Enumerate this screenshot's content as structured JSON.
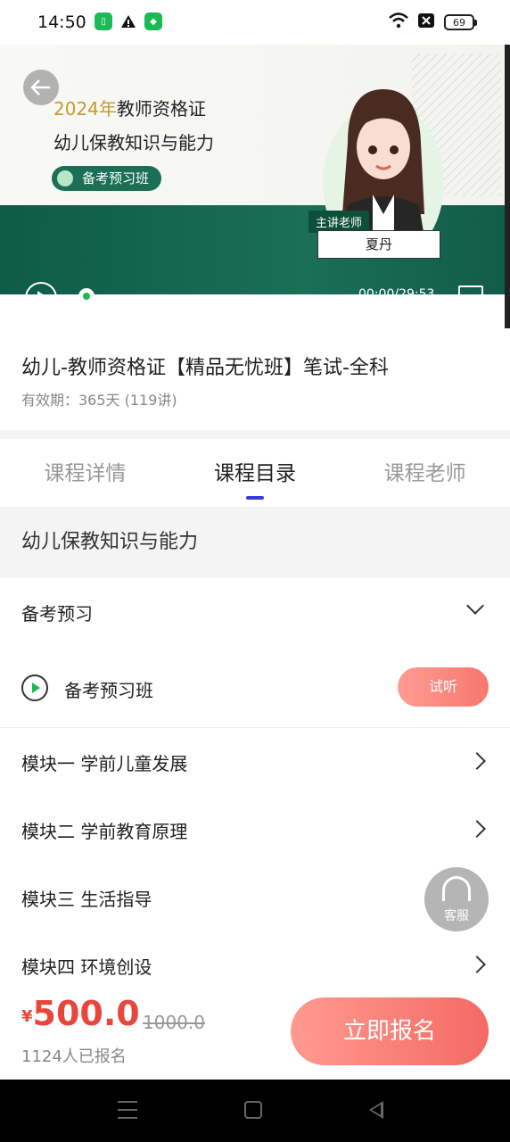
{
  "status_bar": {
    "time": "14:50",
    "left_icons": [
      "sim-icon",
      "warning-icon",
      "shield-icon"
    ],
    "right_icons": [
      "wifi-icon",
      "x-icon"
    ],
    "battery": "69"
  },
  "banner": {
    "year_text": "2024年",
    "title_rest": "教师资格证",
    "subtitle": "幼儿保教知识与能力",
    "pill": "备考预习班",
    "teacher_tag": "主讲老师",
    "teacher_name": "夏丹",
    "video_time": "00:00/29:53",
    "progress": 0.0
  },
  "course": {
    "title": "幼儿-教师资格证【精品无忧班】笔试-全科",
    "validity": "有效期：365天 (119讲)"
  },
  "tabs": [
    {
      "label": "课程详情",
      "active": false
    },
    {
      "label": "课程目录",
      "active": true
    },
    {
      "label": "课程老师",
      "active": false
    }
  ],
  "catalog": {
    "section": "幼儿保教知识与能力",
    "group": "备考预习",
    "lesson": {
      "label": "备考预习班",
      "button": "试听"
    },
    "modules": [
      "模块一 学前儿童发展",
      "模块二 学前教育原理",
      "模块三 生活指导",
      "模块四 环境创设"
    ]
  },
  "customer_service": {
    "label": "客服"
  },
  "footer": {
    "currency": "¥",
    "price": "500.0",
    "original_price": "1000.0",
    "enrolled": "1124人已报名",
    "signup_button": "立即报名"
  },
  "colors": {
    "accent_green": "#1a6f55",
    "price_red": "#e8453c",
    "tab_indicator": "#3a3ae0",
    "button_gradient": "#f46a63"
  }
}
